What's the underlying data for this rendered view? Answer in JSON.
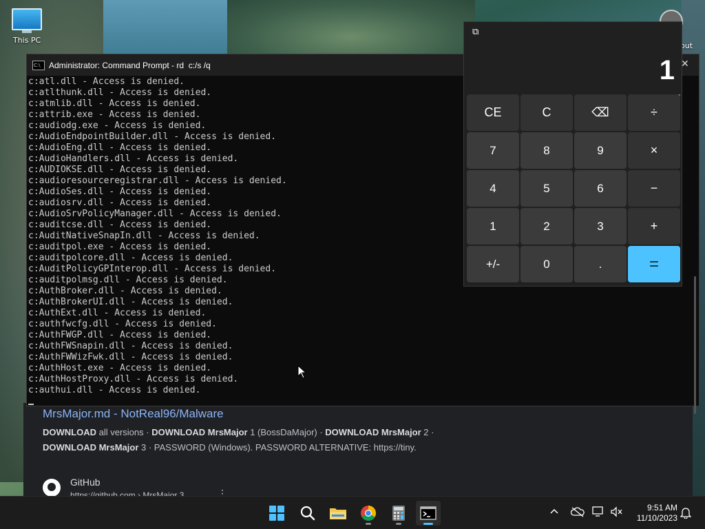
{
  "desktop": {
    "this_pc_label": "This PC",
    "corner_text": "out"
  },
  "browser": {
    "result_title": "MrsMajor.md - NotReal96/Malware",
    "snippet_line1": [
      {
        "t": "DOWNLOAD",
        "b": true
      },
      {
        "t": " all versions · ",
        "b": false
      },
      {
        "t": "DOWNLOAD MrsMajor",
        "b": true
      },
      {
        "t": " 1 (BossDaMajor) · ",
        "b": false
      },
      {
        "t": "DOWNLOAD MrsMajor",
        "b": true
      },
      {
        "t": " 2 ·",
        "b": false
      }
    ],
    "snippet_line2": [
      {
        "t": "DOWNLOAD MrsMajor",
        "b": true
      },
      {
        "t": " 3 · PASSWORD (Windows). PASSWORD ALTERNATIVE: https://tiny.",
        "b": false
      }
    ],
    "site_name": "GitHub",
    "site_url": "https://github.com › MrsMajor 3",
    "more_icon": "⋮"
  },
  "cmd": {
    "title": "Administrator: Command Prompt - rd  c:/s /q",
    "icon_label": "C:\\",
    "close_icon": "✕",
    "lines": [
      "c:atl.dll - Access is denied.",
      "c:atlthunk.dll - Access is denied.",
      "c:atmlib.dll - Access is denied.",
      "c:attrib.exe - Access is denied.",
      "c:audiodg.exe - Access is denied.",
      "c:AudioEndpointBuilder.dll - Access is denied.",
      "c:AudioEng.dll - Access is denied.",
      "c:AudioHandlers.dll - Access is denied.",
      "c:AUDIOKSE.dll - Access is denied.",
      "c:audioresourceregistrar.dll - Access is denied.",
      "c:AudioSes.dll - Access is denied.",
      "c:audiosrv.dll - Access is denied.",
      "c:AudioSrvPolicyManager.dll - Access is denied.",
      "c:auditcse.dll - Access is denied.",
      "c:AuditNativeSnapIn.dll - Access is denied.",
      "c:auditpol.exe - Access is denied.",
      "c:auditpolcore.dll - Access is denied.",
      "c:AuditPolicyGPInterop.dll - Access is denied.",
      "c:auditpolmsg.dll - Access is denied.",
      "c:AuthBroker.dll - Access is denied.",
      "c:AuthBrokerUI.dll - Access is denied.",
      "c:AuthExt.dll - Access is denied.",
      "c:authfwcfg.dll - Access is denied.",
      "c:AuthFWGP.dll - Access is denied.",
      "c:AuthFWSnapin.dll - Access is denied.",
      "c:AuthFWWizFwk.dll - Access is denied.",
      "c:AuthHost.exe - Access is denied.",
      "c:AuthHostProxy.dll - Access is denied.",
      "c:authui.dll - Access is denied."
    ]
  },
  "calculator": {
    "display": "1",
    "restore_icon": "⧉",
    "buttons": [
      {
        "label": "CE",
        "kind": "op",
        "name": "clear-entry-button"
      },
      {
        "label": "C",
        "kind": "op",
        "name": "clear-button"
      },
      {
        "label": "⌫",
        "kind": "op",
        "name": "backspace-button"
      },
      {
        "label": "÷",
        "kind": "op",
        "name": "divide-button"
      },
      {
        "label": "7",
        "kind": "num",
        "name": "digit-7-button"
      },
      {
        "label": "8",
        "kind": "num",
        "name": "digit-8-button"
      },
      {
        "label": "9",
        "kind": "num",
        "name": "digit-9-button"
      },
      {
        "label": "×",
        "kind": "op",
        "name": "multiply-button"
      },
      {
        "label": "4",
        "kind": "num",
        "name": "digit-4-button"
      },
      {
        "label": "5",
        "kind": "num",
        "name": "digit-5-button"
      },
      {
        "label": "6",
        "kind": "num",
        "name": "digit-6-button"
      },
      {
        "label": "−",
        "kind": "op",
        "name": "subtract-button"
      },
      {
        "label": "1",
        "kind": "num",
        "name": "digit-1-button"
      },
      {
        "label": "2",
        "kind": "num",
        "name": "digit-2-button"
      },
      {
        "label": "3",
        "kind": "num",
        "name": "digit-3-button"
      },
      {
        "label": "+",
        "kind": "op",
        "name": "add-button"
      },
      {
        "label": "+/-",
        "kind": "num",
        "name": "negate-button"
      },
      {
        "label": "0",
        "kind": "num",
        "name": "digit-0-button"
      },
      {
        "label": ".",
        "kind": "num",
        "name": "decimal-button"
      },
      {
        "label": "=",
        "kind": "eq",
        "name": "equals-button"
      }
    ],
    "accent_color": "#4cc2ff"
  },
  "taskbar": {
    "apps": [
      {
        "name": "start-button",
        "icon": "windows-logo-icon",
        "active": false,
        "running": false
      },
      {
        "name": "search-button",
        "icon": "search-icon",
        "active": false,
        "running": false
      },
      {
        "name": "file-explorer-button",
        "icon": "folder-icon",
        "active": false,
        "running": false
      },
      {
        "name": "chrome-button",
        "icon": "chrome-icon",
        "active": false,
        "running": true
      },
      {
        "name": "calculator-button",
        "icon": "calculator-icon",
        "active": false,
        "running": true
      },
      {
        "name": "command-prompt-button",
        "icon": "terminal-icon",
        "active": true,
        "running": true
      }
    ],
    "tray": {
      "chevron": "^",
      "time": "9:51 AM",
      "date": "11/10/2023"
    }
  }
}
